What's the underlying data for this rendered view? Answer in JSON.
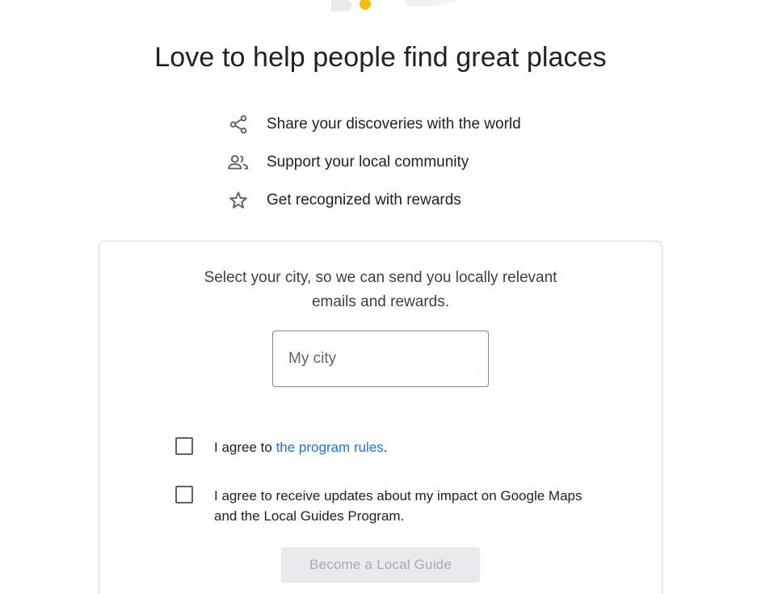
{
  "title": "Love to help people find great places",
  "benefits": [
    {
      "icon": "share-icon",
      "text": "Share your discoveries with the world"
    },
    {
      "icon": "people-icon",
      "text": "Support your local community"
    },
    {
      "icon": "star-icon",
      "text": "Get recognized with rewards"
    }
  ],
  "card": {
    "intro_line1": "Select your city, so we can send you locally relevant",
    "intro_line2": "emails and rewards.",
    "city_input": {
      "placeholder": "My city",
      "value": ""
    },
    "rules_agreement": {
      "prefix": "I agree to ",
      "link_text": "the program rules",
      "suffix": "."
    },
    "updates_agreement": {
      "line1": "I agree to receive updates about my impact on Google Maps",
      "line2": "and the Local Guides Program."
    },
    "submit_label": "Become a Local Guide"
  },
  "colors": {
    "link": "#1a73e8",
    "icon": "#5f6368",
    "disabled_button_bg": "#e8eaed",
    "disabled_button_text": "#a8aaad",
    "illustration_accent": "#fbbc04"
  }
}
